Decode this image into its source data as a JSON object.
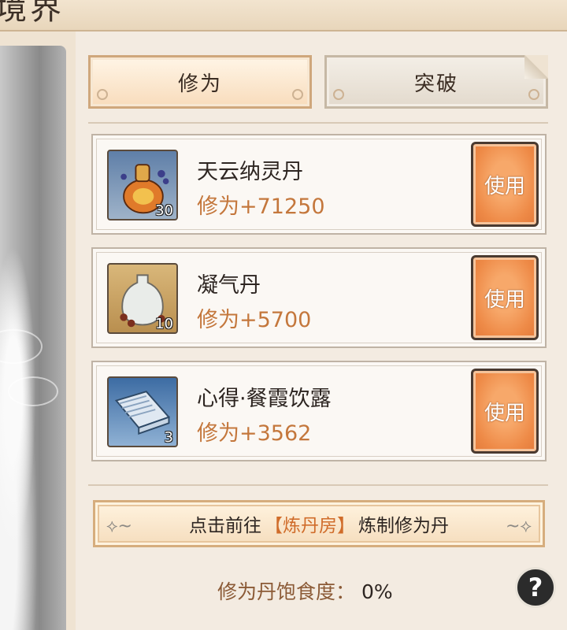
{
  "header": {
    "title": "境界"
  },
  "tabs": [
    {
      "label": "修为",
      "active": true
    },
    {
      "label": "突破",
      "active": false
    }
  ],
  "items": [
    {
      "name": "天云纳灵丹",
      "value": "修为+71250",
      "count": "30",
      "icon": "gourd-pill-icon",
      "use_label": "使用"
    },
    {
      "name": "凝气丹",
      "value": "修为+5700",
      "count": "10",
      "icon": "vase-pill-icon",
      "use_label": "使用"
    },
    {
      "name": "心得·餐霞饮露",
      "value": "修为+3562",
      "count": "3",
      "icon": "scroll-book-icon",
      "use_label": "使用"
    }
  ],
  "banner": {
    "prefix": "点击前往",
    "highlight": "【炼丹房】",
    "suffix": "炼制修为丹"
  },
  "satiety": {
    "label": "修为丹饱食度：",
    "value": "0%"
  },
  "help": {
    "label": "?"
  },
  "colors": {
    "accent_orange": "#c4773c",
    "button_orange": "#ee8a47",
    "highlight": "#d06c2a"
  }
}
